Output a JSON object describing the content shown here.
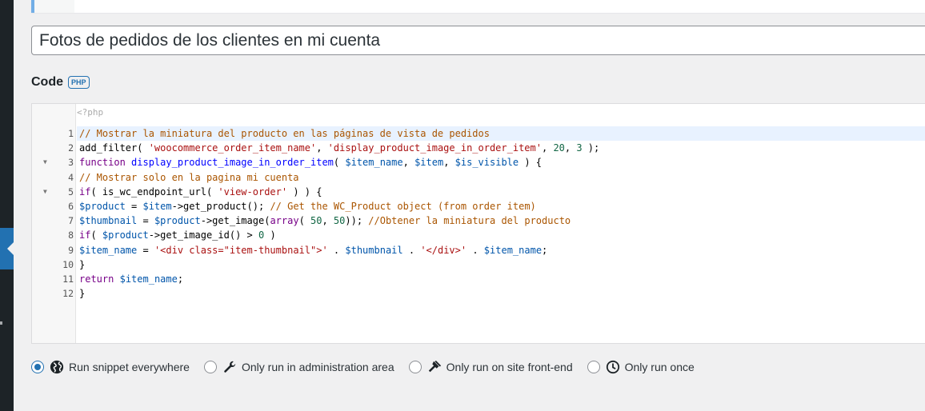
{
  "title_field": {
    "value": "Fotos de pedidos de los clientes en mi cuenta"
  },
  "code_section": {
    "label": "Code",
    "language_badge": "PHP",
    "php_open_tag": "<?php",
    "lines": [
      {
        "num": "1",
        "text": "// Mostrar la miniatura del producto en las páginas de vista de pedidos"
      },
      {
        "num": "2",
        "text": "add_filter( 'woocommerce_order_item_name', 'display_product_image_in_order_item', 20, 3 );"
      },
      {
        "num": "3",
        "text": "function display_product_image_in_order_item( $item_name, $item, $is_visible ) {"
      },
      {
        "num": "4",
        "text": "// Mostrar solo en la pagina mi cuenta"
      },
      {
        "num": "5",
        "text": "if( is_wc_endpoint_url( 'view-order' ) ) {"
      },
      {
        "num": "6",
        "text": "$product = $item->get_product(); // Get the WC_Product object (from order item)"
      },
      {
        "num": "7",
        "text": "$thumbnail = $product->get_image(array( 50, 50)); //Obtener la miniatura del producto"
      },
      {
        "num": "8",
        "text": "if( $product->get_image_id() > 0 )"
      },
      {
        "num": "9",
        "text": "$item_name = '<div class=\"item-thumbnail\">' . $thumbnail . '</div>' . $item_name;"
      },
      {
        "num": "10",
        "text": "}"
      },
      {
        "num": "11",
        "text": "return $item_name;"
      },
      {
        "num": "12",
        "text": "}"
      }
    ]
  },
  "scope_options": [
    {
      "label": "Run snippet everywhere",
      "icon": "globe-icon",
      "checked": true
    },
    {
      "label": "Only run in administration area",
      "icon": "wrench-icon",
      "checked": false
    },
    {
      "label": "Only run on site front-end",
      "icon": "hammer-icon",
      "checked": false
    },
    {
      "label": "Only run once",
      "icon": "clock-icon",
      "checked": false
    }
  ],
  "colors": {
    "accent": "#2271b1",
    "sidebar": "#1d2327",
    "background": "#f0f0f1"
  }
}
